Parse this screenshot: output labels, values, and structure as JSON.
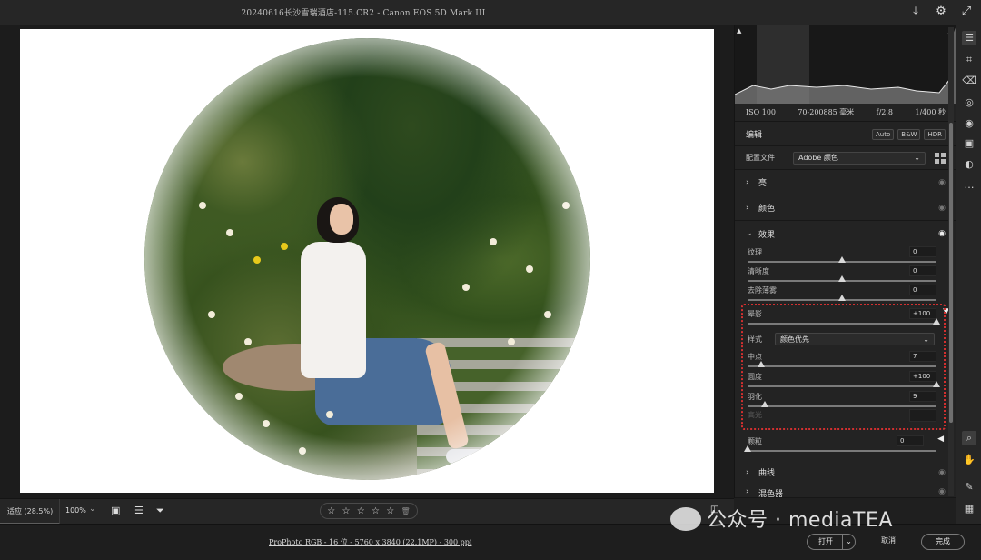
{
  "window": {
    "title": "20240616长沙雪瑞酒店-115.CR2 - Canon EOS 5D Mark III"
  },
  "top_icons": [
    "download-icon",
    "gear-icon",
    "expand-icon"
  ],
  "histogram": {
    "meta": {
      "iso": "ISO 100",
      "lens": "70-200885 毫米",
      "aperture": "f/2.8",
      "shutter": "1/400 秒"
    }
  },
  "edit": {
    "label": "编辑",
    "auto": "Auto",
    "bw": "B&W",
    "hdr": "HDR"
  },
  "profile": {
    "label": "配置文件",
    "value": "Adobe 颜色"
  },
  "sections": {
    "light": "亮",
    "color": "颜色",
    "effects": "效果",
    "curve": "曲线",
    "mixer": "混色器"
  },
  "effects_sliders": [
    {
      "label": "纹理",
      "value": "0",
      "position": 0.5
    },
    {
      "label": "清晰度",
      "value": "0",
      "position": 0.5
    },
    {
      "label": "去除薄雾",
      "value": "0",
      "position": 0.5
    }
  ],
  "vignette": {
    "label": "晕影",
    "value": "+100",
    "position": 1.0,
    "style_label": "样式",
    "style_value": "颜色优先",
    "midpoint": {
      "label": "中点",
      "value": "7",
      "position": 0.07
    },
    "roundness": {
      "label": "圆度",
      "value": "+100",
      "position": 1.0
    },
    "feather": {
      "label": "羽化",
      "value": "9",
      "position": 0.09
    },
    "highlights": {
      "label": "高光",
      "value": ""
    }
  },
  "grain": {
    "label": "颗粒",
    "value": "0",
    "position": 0.0
  },
  "bottom": {
    "zoom_fit": "适应 (28.5%)",
    "zoom_100": "100%",
    "stars": [
      "☆",
      "☆",
      "☆",
      "☆",
      "☆"
    ]
  },
  "footer": {
    "info": "ProPhoto RGB - 16 位 - 5760 x 3840 (22.1MP) - 300 ppi",
    "open": "打开",
    "cancel": "取消",
    "done": "完成"
  },
  "watermark": "公众号 · mediaTEA"
}
